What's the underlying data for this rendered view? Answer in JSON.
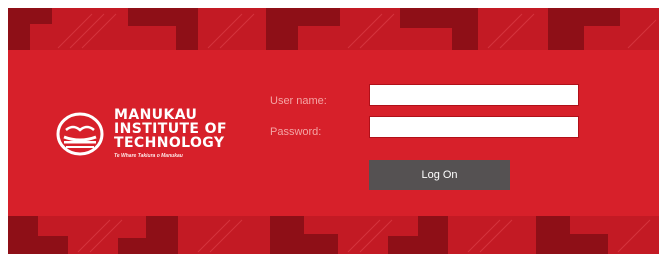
{
  "logo": {
    "icon": "manukau-waka-icon",
    "line1": "MANUKAU",
    "line2": "INSTITUTE OF",
    "line3": "TECHNOLOGY",
    "tagline": "Te Whare Takiura o Manukau"
  },
  "login": {
    "username_label": "User name:",
    "username_value": "",
    "password_label": "Password:",
    "password_value": "",
    "submit_label": "Log On"
  },
  "colors": {
    "background": "#d7202a",
    "pattern_dark": "#8e0f17",
    "button": "#555152"
  }
}
